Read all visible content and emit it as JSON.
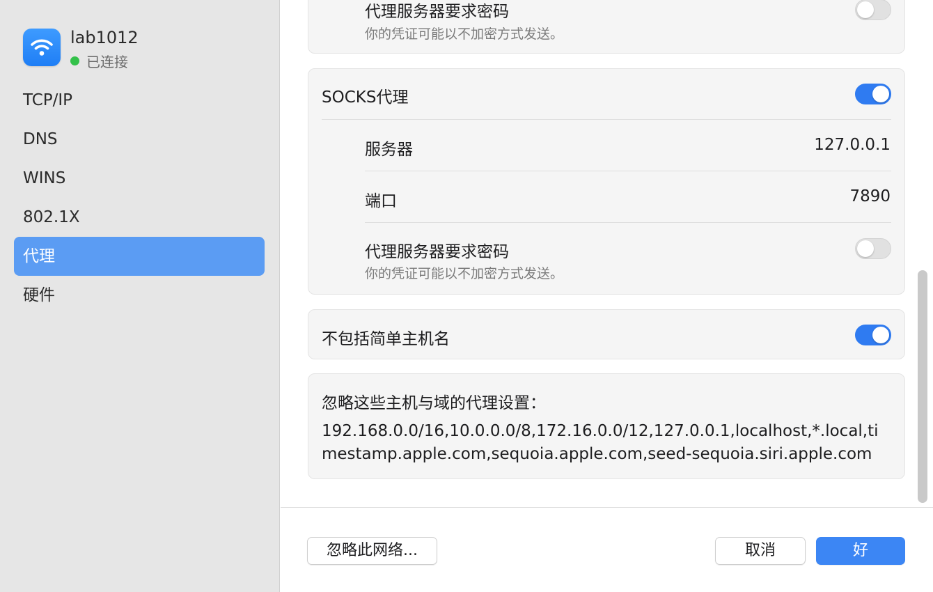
{
  "network": {
    "name": "lab1012",
    "status": "已连接",
    "icon": "wifi-icon",
    "status_color": "#33c14a"
  },
  "sidebar": {
    "items": [
      {
        "label": "TCP/IP"
      },
      {
        "label": "DNS"
      },
      {
        "label": "WINS"
      },
      {
        "label": "802.1X"
      },
      {
        "label": "代理",
        "selected": true
      },
      {
        "label": "硬件"
      }
    ]
  },
  "proxy_top": {
    "password_label": "代理服务器要求密码",
    "password_note": "你的凭证可能以不加密方式发送。",
    "password_required": false
  },
  "socks": {
    "label": "SOCKS代理",
    "enabled": true,
    "server_label": "服务器",
    "server_value": "127.0.0.1",
    "port_label": "端口",
    "port_value": "7890",
    "password_label": "代理服务器要求密码",
    "password_note": "你的凭证可能以不加密方式发送。",
    "password_required": false
  },
  "exclude_simple": {
    "label": "不包括简单主机名",
    "enabled": true
  },
  "bypass": {
    "label": "忽略这些主机与域的代理设置：",
    "value": "192.168.0.0/16,10.0.0.0/8,172.16.0.0/12,127.0.0.1,localhost,*.local,timestamp.apple.com,sequoia.apple.com,seed-sequoia.siri.apple.com"
  },
  "footer": {
    "forget_label": "忽略此网络...",
    "cancel_label": "取消",
    "ok_label": "好"
  },
  "colors": {
    "accent": "#2f7bf1",
    "sidebar_selected": "#5b9cf3"
  }
}
